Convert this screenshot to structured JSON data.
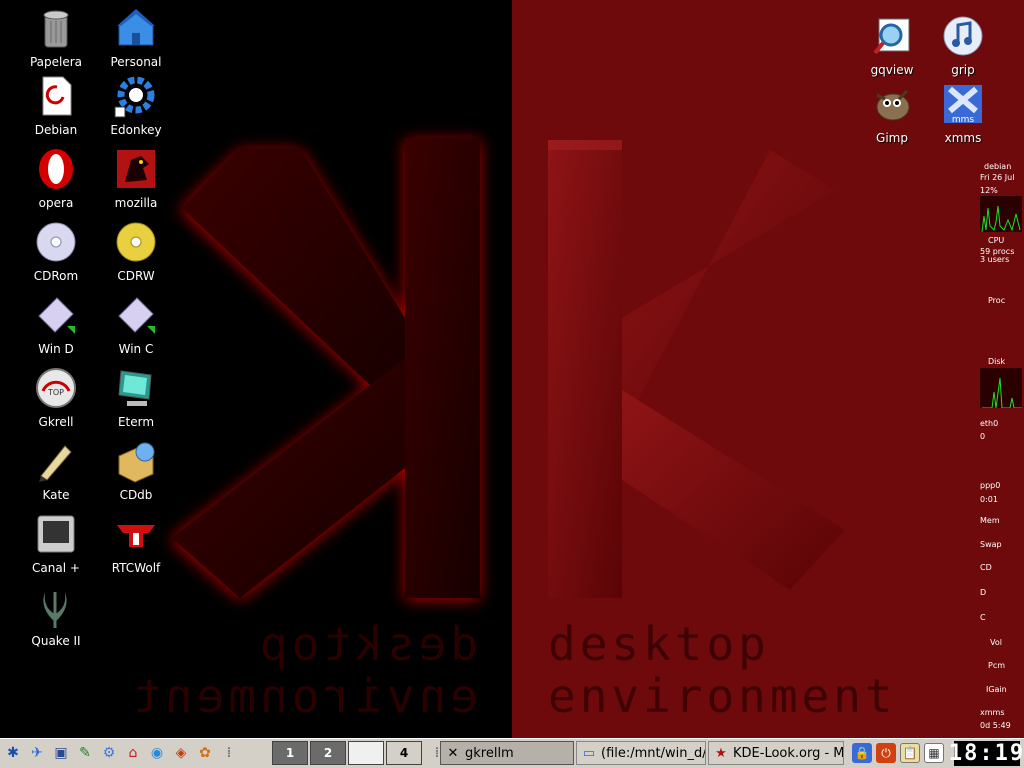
{
  "wallpaper": {
    "line1": "desktop",
    "line2": "environment"
  },
  "desktop_icons": [
    {
      "label": "Papelera",
      "icon": "trash-icon"
    },
    {
      "label": "Personal",
      "icon": "home-folder-icon"
    },
    {
      "label": "Debian",
      "icon": "debian-document-icon"
    },
    {
      "label": "Edonkey",
      "icon": "gear-icon"
    },
    {
      "label": "opera",
      "icon": "opera-icon"
    },
    {
      "label": "mozilla",
      "icon": "mozilla-icon"
    },
    {
      "label": "CDRom",
      "icon": "cdrom-icon"
    },
    {
      "label": "CDRW",
      "icon": "cdrw-icon"
    },
    {
      "label": "Win D",
      "icon": "drive-icon"
    },
    {
      "label": "Win C",
      "icon": "drive-icon"
    },
    {
      "label": "Gkrell",
      "icon": "gauge-icon"
    },
    {
      "label": "Eterm",
      "icon": "monitor-icon"
    },
    {
      "label": "Kate",
      "icon": "pen-icon"
    },
    {
      "label": "CDdb",
      "icon": "package-icon"
    },
    {
      "label": "Canal +",
      "icon": "tv-icon"
    },
    {
      "label": "RTCWolf",
      "icon": "wolf-icon"
    },
    {
      "label": "Quake II",
      "icon": "quake-icon"
    },
    {
      "label": "gqview",
      "icon": "image-viewer-icon"
    },
    {
      "label": "grip",
      "icon": "music-icon"
    },
    {
      "label": "Gimp",
      "icon": "gimp-icon"
    },
    {
      "label": "xmms",
      "icon": "xmms-icon"
    }
  ],
  "gkrellm": {
    "host": "debian",
    "date": "Fri 26 Jul",
    "cpu_percent": "12%",
    "cpu_label": "CPU",
    "procs": "59 procs",
    "users": "3 users",
    "proc_label": "Proc",
    "disk_label": "Disk",
    "eth0_label": "eth0",
    "eth0_value": "0",
    "ppp0_label": "ppp0",
    "ppp0_value": "0:01",
    "mem_label": "Mem",
    "swap_label": "Swap",
    "cd_label": "CD",
    "d_label": "D",
    "c_label": "C",
    "vol_label": "Vol",
    "pcm_label": "Pcm",
    "igain_label": "IGain",
    "xmms_label": "xmms",
    "uptime": "0d 5:49"
  },
  "taskbar": {
    "pager": [
      "1",
      "2",
      "",
      "4"
    ],
    "tasks": [
      {
        "label": "gkrellm",
        "icon": "x-icon"
      },
      {
        "label": "(file:/mnt/win_d/",
        "icon": "folder-icon"
      },
      {
        "label": "KDE-Look.org - M",
        "icon": "star-icon"
      }
    ],
    "clock": "18:19"
  },
  "colors": {
    "wallpaper_red": "#6e0a0c",
    "taskbar": "#d4d0c8"
  }
}
